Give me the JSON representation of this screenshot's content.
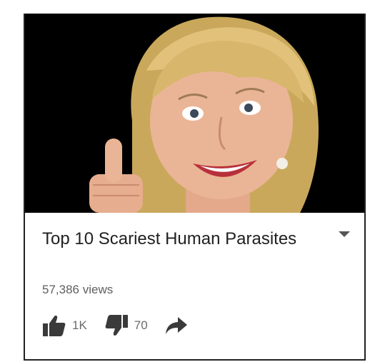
{
  "video": {
    "title": "Top 10 Scariest Human Parasites",
    "views": "57,386 views",
    "likes": "1K",
    "dislikes": "70"
  },
  "icons": {
    "like": "thumbs-up-icon",
    "dislike": "thumbs-down-icon",
    "share": "share-arrow-icon",
    "menu": "dropdown-caret-icon"
  },
  "colors": {
    "thumbnail_bg": "#000000",
    "title_text": "#212121",
    "meta_text": "#5f5f5f",
    "icon": "#3a3a3a"
  }
}
